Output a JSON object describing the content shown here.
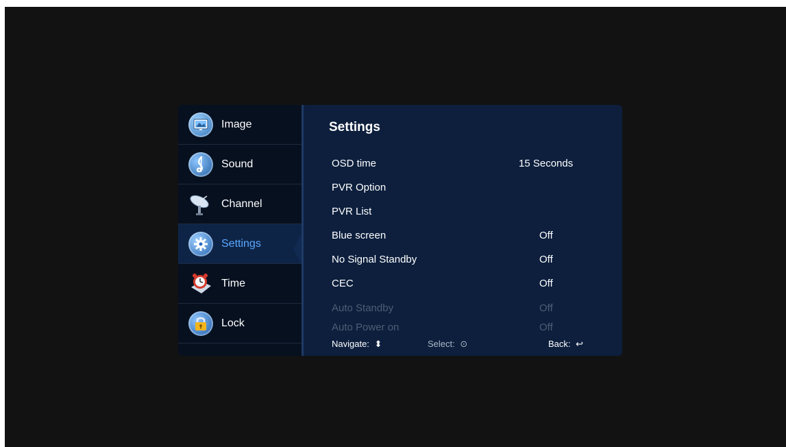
{
  "sidebar": {
    "items": [
      {
        "label": "Image",
        "icon": "image-icon"
      },
      {
        "label": "Sound",
        "icon": "music-note-icon"
      },
      {
        "label": "Channel",
        "icon": "satellite-dish-icon"
      },
      {
        "label": "Settings",
        "icon": "gear-icon",
        "active": true
      },
      {
        "label": "Time",
        "icon": "alarm-clock-icon"
      },
      {
        "label": "Lock",
        "icon": "padlock-icon"
      }
    ]
  },
  "content": {
    "title": "Settings",
    "rows": [
      {
        "name": "OSD time",
        "value": "15 Seconds",
        "enabled": true
      },
      {
        "name": "PVR Option",
        "value": "",
        "enabled": true
      },
      {
        "name": "PVR List",
        "value": "",
        "enabled": true
      },
      {
        "name": "Blue screen",
        "value": "Off",
        "enabled": true
      },
      {
        "name": "No Signal Standby",
        "value": "Off",
        "enabled": true
      },
      {
        "name": "CEC",
        "value": "Off",
        "enabled": true
      },
      {
        "name": "Auto Standby",
        "value": "Off",
        "enabled": false
      },
      {
        "name": "Auto Power on",
        "value": "Off",
        "enabled": false
      }
    ]
  },
  "footer": {
    "navigate": "Navigate:",
    "navigate_symbol": "⬍",
    "select": "Select:",
    "select_symbol": "⊙",
    "back": "Back:",
    "back_symbol": "↩"
  },
  "colors": {
    "screen_bg": "#121212",
    "sidebar_bg": "#06101f",
    "content_bg": "#0d1f3d",
    "active_text": "#5aa9ff",
    "disabled_text": "#4f5d75"
  }
}
